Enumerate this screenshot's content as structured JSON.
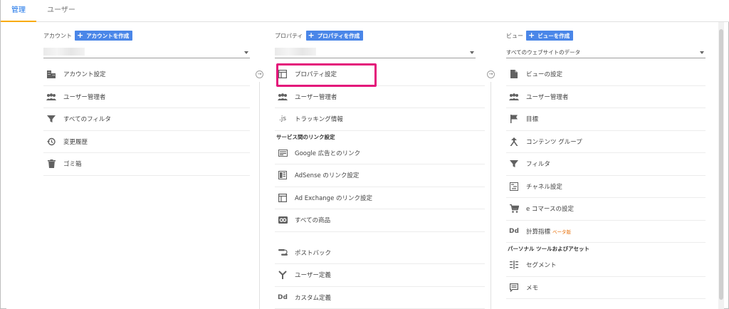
{
  "tabs": [
    {
      "label": "管理",
      "active": true
    },
    {
      "label": "ユーザー",
      "active": false
    }
  ],
  "account": {
    "title": "アカウント",
    "create_label": "アカウントを作成",
    "selected": "",
    "items": [
      {
        "icon": "building-icon",
        "label": "アカウント設定"
      },
      {
        "icon": "users-icon",
        "label": "ユーザー管理者"
      },
      {
        "icon": "filter-icon",
        "label": "すべてのフィルタ"
      },
      {
        "icon": "history-icon",
        "label": "変更履歴"
      },
      {
        "icon": "trash-icon",
        "label": "ゴミ箱"
      }
    ]
  },
  "property": {
    "title": "プロパティ",
    "create_label": "プロパティを作成",
    "selected": "",
    "items": [
      {
        "icon": "window-icon",
        "label": "プロパティ設定"
      },
      {
        "icon": "users-icon",
        "label": "ユーザー管理者"
      },
      {
        "icon": "js-icon",
        "icon_text": ".js",
        "label": "トラッキング情報"
      }
    ],
    "section_label": "サービス間のリンク設定",
    "link_items": [
      {
        "icon": "google-ads-icon",
        "label": "Google 広告とのリンク"
      },
      {
        "icon": "adsense-icon",
        "label": "AdSense のリンク設定"
      },
      {
        "icon": "ad-exchange-icon",
        "label": "Ad Exchange のリンク設定"
      },
      {
        "icon": "link-products-icon",
        "label": "すべての商品"
      }
    ],
    "more_items": [
      {
        "icon": "postback-icon",
        "label": "ポストバック"
      },
      {
        "icon": "user-definition-icon",
        "label": "ユーザー定義"
      },
      {
        "icon": "custom-definition-icon",
        "icon_text": "Dd",
        "label": "カスタム定義"
      }
    ]
  },
  "view": {
    "title": "ビュー",
    "create_label": "ビューを作成",
    "selected": "すべてのウェブサイトのデータ",
    "items": [
      {
        "icon": "document-icon",
        "label": "ビューの設定"
      },
      {
        "icon": "users-icon",
        "label": "ユーザー管理者"
      },
      {
        "icon": "flag-icon",
        "label": "目標"
      },
      {
        "icon": "content-grouping-icon",
        "label": "コンテンツ グループ"
      },
      {
        "icon": "filter-icon",
        "label": "フィルタ"
      },
      {
        "icon": "channel-settings-icon",
        "label": "チャネル設定"
      },
      {
        "icon": "cart-icon",
        "label": "e コマースの設定"
      },
      {
        "icon": "calculated-metrics-icon",
        "icon_text": "Dd",
        "label": "計算指標",
        "badge": "ベータ版"
      }
    ],
    "section_label": "パーソナル ツールおよびアセット",
    "tool_items": [
      {
        "icon": "segment-icon",
        "label": "セグメント"
      },
      {
        "icon": "memo-icon",
        "label": "メモ"
      }
    ]
  },
  "colors": {
    "accent": "#1a73e8",
    "create_button": "#4a86e8",
    "tab_underline": "#f9ab00",
    "highlight": "#e4157a"
  }
}
